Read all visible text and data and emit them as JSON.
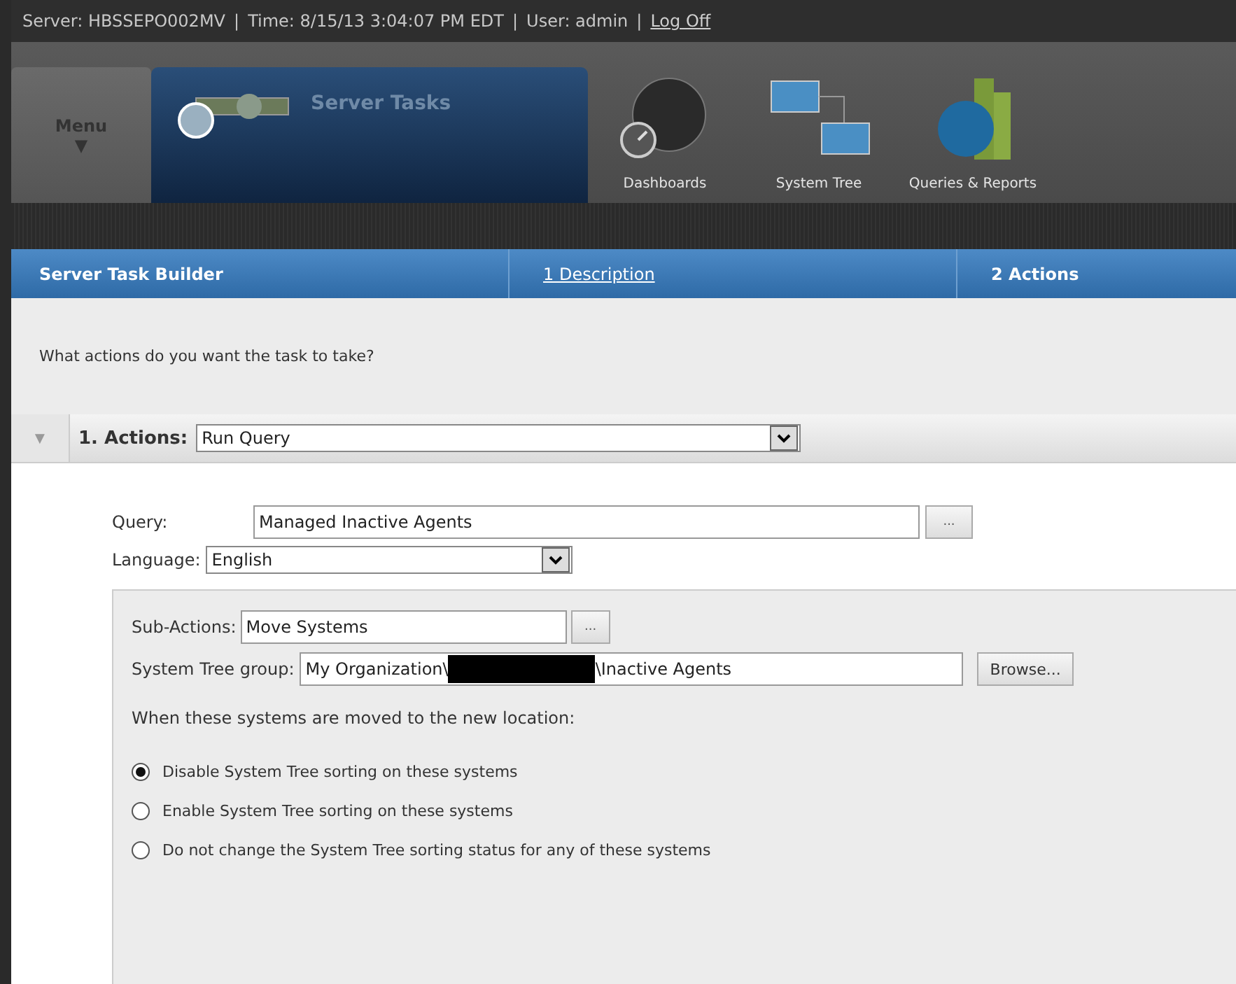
{
  "header": {
    "server": "Server: HBSSEPO002MV",
    "time": "Time: 8/15/13 3:04:07 PM EDT",
    "user": "User: admin",
    "separator": "|",
    "log_off": "Log Off"
  },
  "nav": {
    "menu": {
      "label": "Menu",
      "arrow": "▼"
    },
    "current": "Server Tasks",
    "items": [
      {
        "kind": "gauge",
        "label": "Dashboards"
      },
      {
        "kind": "tree",
        "label": "System Tree"
      },
      {
        "kind": "chart",
        "label": "Queries & Reports"
      }
    ]
  },
  "builder": {
    "title": "Server Task Builder",
    "steps": [
      {
        "label": "1 Description",
        "selected": false
      },
      {
        "label": "2 Actions",
        "selected": true
      }
    ],
    "question": "What actions do you want the task to take?",
    "action": {
      "expanded": true,
      "label": "1. Actions:",
      "value": "Run Query"
    },
    "query": {
      "label": "Query:",
      "value": "Managed Inactive Agents",
      "button": "..."
    },
    "language": {
      "label": "Language:",
      "value": "English"
    },
    "sub_actions": {
      "label": "Sub-Actions:",
      "value": "Move Systems",
      "button": "..."
    },
    "group": {
      "label": "System Tree group:",
      "value_before_redaction": "My Organization\\",
      "value_after_redaction": "\\Inactive Agents",
      "button": "Browse..."
    },
    "move_prompt": "When these systems are moved to the new location:",
    "options": [
      {
        "label": "Disable System Tree sorting on these systems",
        "selected": true
      },
      {
        "label": "Enable System Tree sorting on these systems",
        "selected": false
      },
      {
        "label": "Do not change the System Tree sorting status for any of these systems",
        "selected": false
      }
    ]
  }
}
